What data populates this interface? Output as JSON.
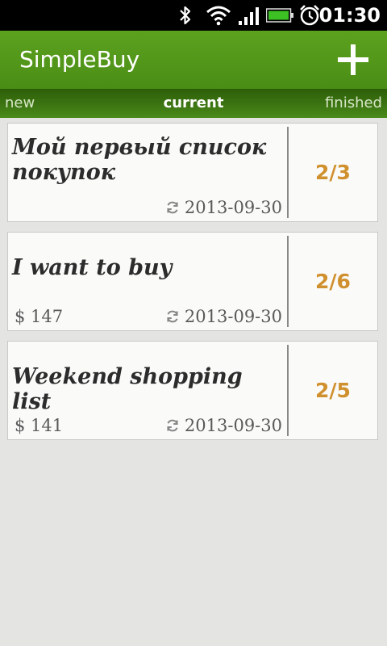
{
  "status_bar": {
    "time": "01:30",
    "icons": [
      "bluetooth-icon",
      "wifi-icon",
      "signal-icon",
      "battery-icon",
      "alarm-icon"
    ]
  },
  "app_bar": {
    "title": "SimpleBuy",
    "add_icon": "plus-icon",
    "color": "#549a1c"
  },
  "tabs": {
    "new": "new",
    "current": "current",
    "finished": "finished",
    "selected": "current"
  },
  "lists": [
    {
      "name": "Мой первый список покупок",
      "price": "",
      "date": "2013-09-30",
      "count": "2/3"
    },
    {
      "name": "I want to buy",
      "price": "$ 147",
      "date": "2013-09-30",
      "count": "2/6"
    },
    {
      "name": "Weekend shopping list",
      "price": "$ 141",
      "date": "2013-09-30",
      "count": "2/5"
    }
  ],
  "colors": {
    "count": "#d0902e",
    "background": "#e4e4e2"
  }
}
